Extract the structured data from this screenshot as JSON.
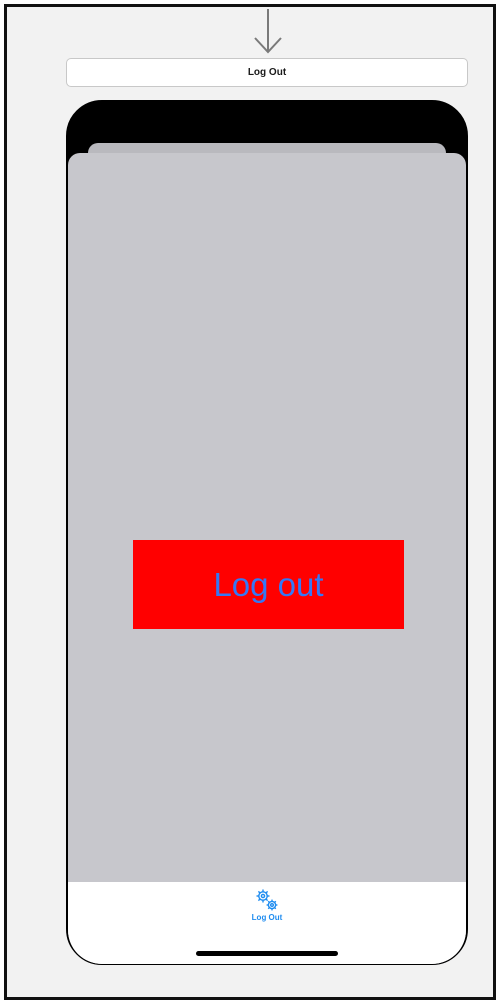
{
  "scene": {
    "title": "Log Out"
  },
  "screen": {
    "button_label": "Log out",
    "button_background": "#ff0000",
    "button_text_color": "#3478f6",
    "background_color": "#c7c7cc"
  },
  "tab_bar": {
    "items": [
      {
        "label": "Log Out",
        "icon": "gears-icon",
        "selected": true
      }
    ],
    "tint_color": "#1e8cf0"
  }
}
